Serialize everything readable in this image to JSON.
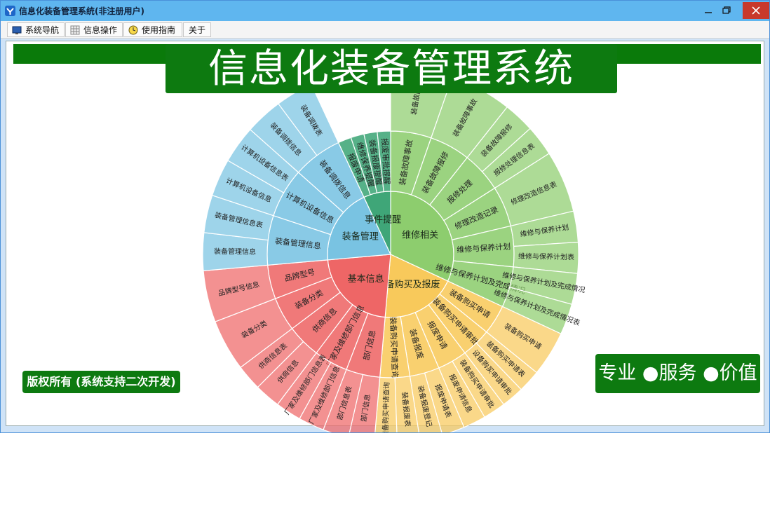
{
  "window": {
    "title": "信息化装备管理系统(非注册用户)"
  },
  "menu": [
    {
      "label": "系统导航",
      "icon": "monitor-icon"
    },
    {
      "label": "信息操作",
      "icon": "grid-icon"
    },
    {
      "label": "使用指南",
      "icon": "clock-icon"
    },
    {
      "label": "关于",
      "icon": ""
    }
  ],
  "banner": {
    "title": "信息化装备管理系统"
  },
  "footer": {
    "copyright": "版权所有 (系统支持二次开发)",
    "slogan": "专业 ●服务 ●价值"
  },
  "colors": {
    "maintenance": "#8dcd6e",
    "purchase": "#f8c95b",
    "basic": "#ee6666",
    "equipment": "#79c3e2",
    "events": "#3fa678",
    "brand_green": "#0d7a10"
  },
  "sunburst": {
    "segments": [
      {
        "label": "维修相关",
        "children": [
          {
            "label": "装备故障事故",
            "children": [
              {
                "label": "装备故障"
              }
            ]
          },
          {
            "label": "装备故障报修",
            "children": [
              {
                "label": "装备故障事故"
              }
            ]
          },
          {
            "label": "报修处理",
            "children": [
              {
                "label": "装备故障报修"
              },
              {
                "label": "报修处理信息表"
              }
            ]
          },
          {
            "label": "修理改造记录",
            "children": [
              {
                "label": "修理改造信息表"
              }
            ]
          },
          {
            "label": "维修与保养计划",
            "children": [
              {
                "label": "维修与保养计划"
              },
              {
                "label": "维修与保养计划表"
              }
            ]
          },
          {
            "label": "维修与保养计划及完成情况",
            "children": [
              {
                "label": "维修与保养计划及完成情况"
              },
              {
                "label": "维修与保养计划及完成情况表"
              }
            ]
          }
        ]
      },
      {
        "label": "装备购买及报废",
        "children": [
          {
            "label": "装备购买申请",
            "children": [
              {
                "label": "装备购买申请"
              }
            ]
          },
          {
            "label": "装备购买申请审批",
            "children": [
              {
                "label": "装备购买申请表"
              },
              {
                "label": "设备购买申请审批"
              }
            ]
          },
          {
            "label": "报废申请",
            "children": [
              {
                "label": "装备购买申请审批"
              },
              {
                "label": "报废申请信息"
              }
            ]
          },
          {
            "label": "装备报废",
            "children": [
              {
                "label": "报废申请表"
              },
              {
                "label": "装备报废登记"
              }
            ]
          },
          {
            "label": "装备购买申请查询",
            "children": [
              {
                "label": "装备报废表"
              },
              {
                "label": "装备购买申请查询"
              }
            ]
          }
        ]
      },
      {
        "label": "基本信息",
        "children": [
          {
            "label": "部门信息",
            "children": [
              {
                "label": "部门信息"
              },
              {
                "label": "部门信息表"
              }
            ]
          },
          {
            "label": "厂家及维修部门信息",
            "children": [
              {
                "label": "厂家及维修部门信息"
              },
              {
                "label": "厂家及维修部门信息表"
              }
            ]
          },
          {
            "label": "供商信息",
            "children": [
              {
                "label": "供商信息"
              },
              {
                "label": "供商信息表"
              }
            ]
          },
          {
            "label": "装备分类",
            "children": [
              {
                "label": "装备分类"
              }
            ]
          },
          {
            "label": "品牌型号",
            "children": [
              {
                "label": "品牌型号信息"
              }
            ]
          }
        ]
      },
      {
        "label": "装备管理",
        "children": [
          {
            "label": "装备管理信息",
            "children": [
              {
                "label": "装备管理信息"
              },
              {
                "label": "装备管理信息表"
              }
            ]
          },
          {
            "label": "计算机设备信息",
            "children": [
              {
                "label": "计算机设备信息"
              },
              {
                "label": "计算机设备信息表"
              }
            ]
          },
          {
            "label": "装备调拨信息",
            "children": [
              {
                "label": "装备调拨信息"
              },
              {
                "label": "装备调拨表"
              }
            ]
          }
        ]
      },
      {
        "label": "事件提醒",
        "children": [
          {
            "label": "报废申请",
            "children": []
          },
          {
            "label": "维修保养提醒",
            "children": []
          },
          {
            "label": "装备报废提醒",
            "children": []
          },
          {
            "label": "报废审批提醒",
            "children": []
          }
        ]
      }
    ]
  }
}
